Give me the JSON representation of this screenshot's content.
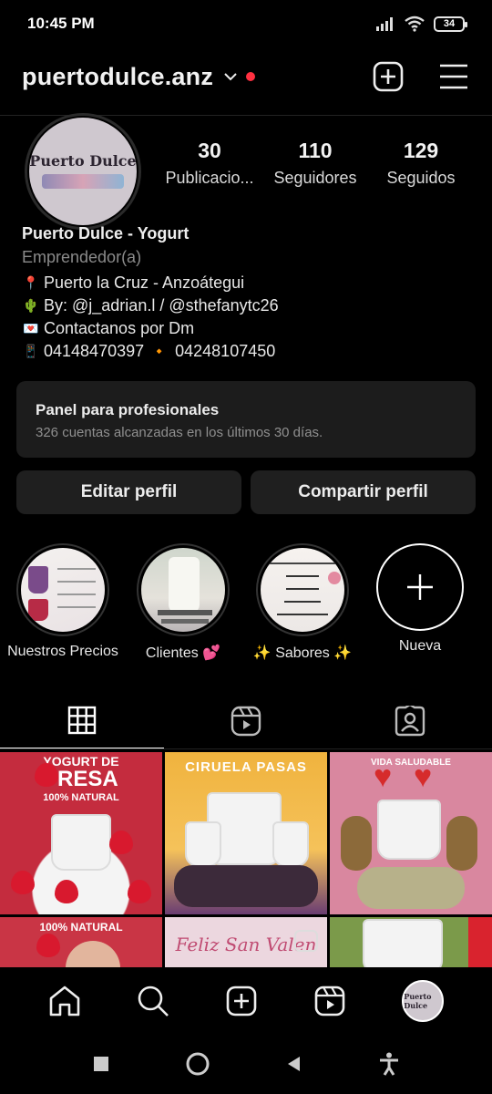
{
  "status_bar": {
    "time": "10:45 PM",
    "battery": "34"
  },
  "header": {
    "username": "puertodulce.anz"
  },
  "profile": {
    "avatar_text": "Puerto Dulce",
    "stats": [
      {
        "num": "30",
        "label": "Publicacio..."
      },
      {
        "num": "110",
        "label": "Seguidores"
      },
      {
        "num": "129",
        "label": "Seguidos"
      }
    ],
    "name": "Puerto Dulce - Yogurt",
    "category": "Emprendedor(a)",
    "bio": {
      "line1": "Puerto la Cruz - Anzoátegui",
      "line2": "By: @j_adrian.l / @sthefanytc26",
      "line3": "Contactanos por Dm",
      "line4a": "04148470397",
      "line4b": "04248107450"
    }
  },
  "panel": {
    "title": "Panel para profesionales",
    "subtitle": "326 cuentas alcanzadas en los últimos 30 días."
  },
  "buttons": {
    "edit": "Editar perfil",
    "share": "Compartir perfil"
  },
  "highlights": [
    {
      "label": "Nuestros Precios"
    },
    {
      "label": "Clientes 💕"
    },
    {
      "label": "✨ Sabores ✨"
    },
    {
      "label": "Nueva"
    }
  ],
  "grid": {
    "post1": {
      "title": "YOGURT DE",
      "big": "FRESA",
      "sub": "100% NATURAL"
    },
    "post2": {
      "title": "CIRUELA PASAS"
    },
    "post3": {
      "title": "VIDA SALUDABLE"
    },
    "post4": {
      "title": "100% NATURAL"
    },
    "post5": {
      "title": "Feliz San Valen"
    }
  },
  "colors": {
    "accent_red": "#ff3040",
    "background": "#000000",
    "surface": "#1f1f1f"
  }
}
